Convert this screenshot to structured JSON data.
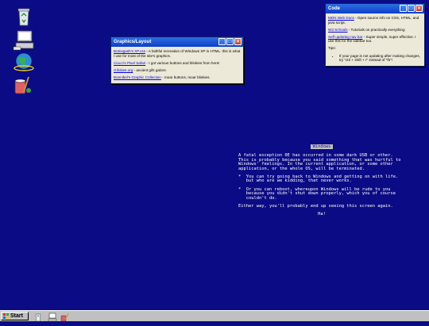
{
  "desktop": {
    "icons": [
      "recycle-bin-icon",
      "my-computer-icon",
      "internet-explorer-icon",
      "paint-icon"
    ]
  },
  "graphics_window": {
    "title": "Graphics/Layout",
    "links": [
      {
        "link": "Botoxgash's XP.css",
        "text": " - A faithful recreation of Windows XP in HTML. this is what I use for most of the site's graphics."
      },
      {
        "link": "Ciocci's Pixel Safari",
        "text": " - I got various buttons and blinkies from here!"
      },
      {
        "link": "Gifcities.org",
        "text": " - ancient gifs galore."
      },
      {
        "link": "Bonnibel's Graphic Collection",
        "text": " - moar buttons, moar blinkies."
      }
    ]
  },
  "code_window": {
    "title": "Code",
    "links": [
      {
        "link": "MDN Web Docs",
        "text": " - Open source info on CSS, HTML, and java script."
      },
      {
        "link": "W3 Schools",
        "text": " - Tutorials on practically everything"
      },
      {
        "link": "Self updating nav bar",
        "text": " - Super simple, super effective. I use this for the sidebar too."
      }
    ],
    "tips_label": "Tips:",
    "tip": "If your page is not updating after making changes, try \"ctrl + shift + r\" instead of \"f5\"!"
  },
  "bsod": {
    "header": "Windows",
    "para1": "A fatal exception 0E has occurred in some dark USB or other. This is probably because you said something that was hurtful to Windows' feelings. In the current application, or some other application, or the whole OS, will be terminated.",
    "bullet1": "*  You can try going back to Windows and getting on with life.\n   but who are we kidding, that never works.",
    "bullet2": "*  Or you can reboot, whereupon Windows will be rude to you\n   because you didn't shut down properly, which you of course\n   couldn't do.",
    "para2": "Either way, you'll probably end up seeing this screen again.",
    "footer": "Ha!"
  },
  "taskbar": {
    "start_label": "Start",
    "quick_launch": [
      "recycle-bin-icon",
      "my-computer-icon",
      "paint-icon"
    ]
  },
  "colors": {
    "desktop": "#0b0b85",
    "titlebar": "#0a3fc8",
    "window_bg": "#ece9d8"
  }
}
